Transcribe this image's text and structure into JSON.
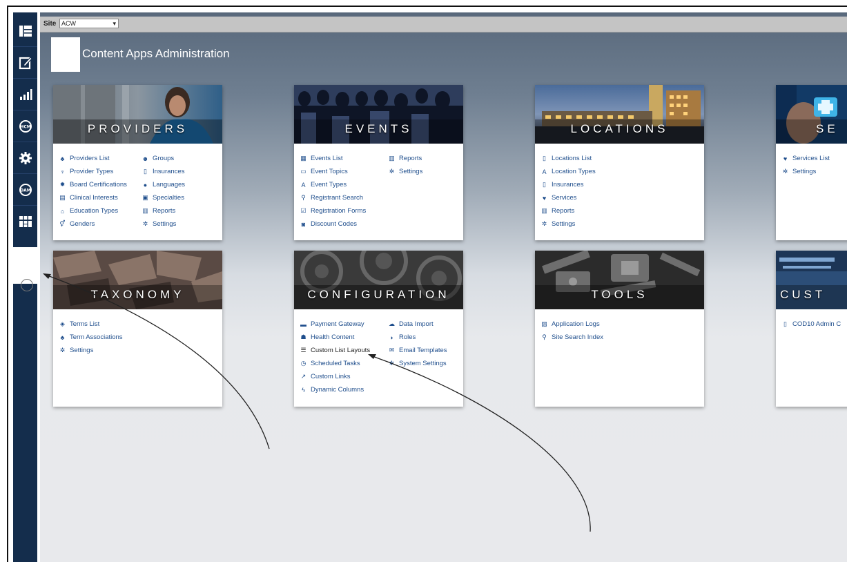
{
  "site": {
    "label": "Site",
    "selected": "ACW"
  },
  "page_title": "Content Apps Administration",
  "sidebar": {
    "icons": [
      "dashboard-icon",
      "edit-icon",
      "analytics-icon",
      "hcm-icon",
      "settings-gear-icon",
      "dam-icon",
      "apps-grid-icon"
    ]
  },
  "cards": {
    "providers": {
      "title": "PROVIDERS",
      "col1": [
        {
          "label": "Providers List",
          "icon": "sitemap-icon"
        },
        {
          "label": "Provider Types",
          "icon": "stethoscope-icon"
        },
        {
          "label": "Board Certifications",
          "icon": "certificate-icon"
        },
        {
          "label": "Clinical Interests",
          "icon": "document-icon"
        },
        {
          "label": "Education Types",
          "icon": "university-icon"
        },
        {
          "label": "Genders",
          "icon": "gender-icon"
        }
      ],
      "col2": [
        {
          "label": "Groups",
          "icon": "users-icon"
        },
        {
          "label": "Insurances",
          "icon": "file-icon"
        },
        {
          "label": "Languages",
          "icon": "globe-icon"
        },
        {
          "label": "Specialties",
          "icon": "medkit-icon"
        },
        {
          "label": "Reports",
          "icon": "report-icon"
        },
        {
          "label": "Settings",
          "icon": "gear-icon"
        }
      ]
    },
    "events": {
      "title": "EVENTS",
      "col1": [
        {
          "label": "Events List",
          "icon": "calendar-icon"
        },
        {
          "label": "Event Topics",
          "icon": "comment-icon"
        },
        {
          "label": "Event Types",
          "icon": "font-icon"
        },
        {
          "label": "Registrant Search",
          "icon": "search-icon"
        },
        {
          "label": "Registration Forms",
          "icon": "form-icon"
        },
        {
          "label": "Discount Codes",
          "icon": "tag-icon"
        }
      ],
      "col2": [
        {
          "label": "Reports",
          "icon": "report-icon"
        },
        {
          "label": "Settings",
          "icon": "gear-icon"
        }
      ]
    },
    "locations": {
      "title": "LOCATIONS",
      "col1": [
        {
          "label": "Locations List",
          "icon": "building-icon"
        },
        {
          "label": "Location Types",
          "icon": "font-icon"
        },
        {
          "label": "Insurances",
          "icon": "file-icon"
        },
        {
          "label": "Services",
          "icon": "heart-icon"
        },
        {
          "label": "Reports",
          "icon": "report-icon"
        },
        {
          "label": "Settings",
          "icon": "gear-icon"
        }
      ]
    },
    "services": {
      "title": "SE",
      "col1": [
        {
          "label": "Services List",
          "icon": "heart-icon"
        },
        {
          "label": "Settings",
          "icon": "gear-icon"
        }
      ]
    },
    "taxonomy": {
      "title": "TAXONOMY",
      "col1": [
        {
          "label": "Terms List",
          "icon": "tags-icon"
        },
        {
          "label": "Term Associations",
          "icon": "sitemap-icon"
        },
        {
          "label": "Settings",
          "icon": "gear-icon"
        }
      ]
    },
    "configuration": {
      "title": "CONFIGURATION",
      "col1": [
        {
          "label": "Payment Gateway",
          "icon": "credit-card-icon"
        },
        {
          "label": "Health Content",
          "icon": "user-md-icon"
        },
        {
          "label": "Custom List Layouts",
          "icon": "list-icon"
        },
        {
          "label": "Scheduled Tasks",
          "icon": "clock-icon"
        },
        {
          "label": "Custom Links",
          "icon": "external-link-icon"
        },
        {
          "label": "Dynamic Columns",
          "icon": "bolt-icon"
        }
      ],
      "col2": [
        {
          "label": "Data Import",
          "icon": "upload-icon"
        },
        {
          "label": "Roles",
          "icon": "shield-icon"
        },
        {
          "label": "Email Templates",
          "icon": "envelope-icon"
        },
        {
          "label": "System Settings",
          "icon": "gear-icon"
        }
      ]
    },
    "tools": {
      "title": "TOOLS",
      "col1": [
        {
          "label": "Application Logs",
          "icon": "logs-icon"
        },
        {
          "label": "Site Search Index",
          "icon": "search-icon"
        }
      ]
    },
    "custom": {
      "title": "CUST",
      "col1": [
        {
          "label": "COD10 Admin C",
          "icon": "file-icon"
        }
      ]
    }
  },
  "colors": {
    "sidebar": "#142d4c",
    "link": "#1f4e8c",
    "header_bg": "#5f6f82"
  }
}
